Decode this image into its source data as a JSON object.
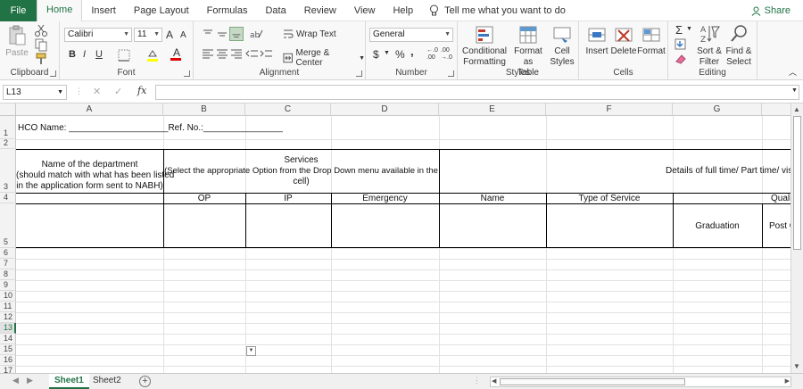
{
  "tabs": {
    "file": "File",
    "items": [
      "Home",
      "Insert",
      "Page Layout",
      "Formulas",
      "Data",
      "Review",
      "View",
      "Help"
    ],
    "tell": "Tell me what you want to do",
    "share": "Share"
  },
  "ribbon": {
    "clipboard": {
      "paste": "Paste",
      "label": "Clipboard"
    },
    "font": {
      "name": "Calibri",
      "size": "11",
      "bold": "B",
      "italic": "I",
      "underline": "U",
      "grow": "A",
      "shrink": "A",
      "label": "Font"
    },
    "alignment": {
      "wrap": "Wrap Text",
      "merge": "Merge & Center",
      "label": "Alignment"
    },
    "number": {
      "format": "General",
      "currency": "$",
      "percent": "%",
      "comma": ",",
      "inc": "←.0 .00",
      "dec": ".00 →.0",
      "label": "Number"
    },
    "styles": {
      "conditional_1": "Conditional",
      "conditional_2": "Formatting",
      "table_1": "Format as",
      "table_2": "Table",
      "cell_1": "Cell",
      "cell_2": "Styles",
      "label": "Styles"
    },
    "cells": {
      "insert": "Insert",
      "delete": "Delete",
      "format": "Format",
      "label": "Cells"
    },
    "editing": {
      "sort_1": "Sort &",
      "sort_2": "Filter",
      "find_1": "Find &",
      "find_2": "Select",
      "label": "Editing"
    }
  },
  "formula_bar": {
    "name_box": "L13",
    "fx": "fx",
    "value": ""
  },
  "grid": {
    "columns": [
      "A",
      "B",
      "C",
      "D",
      "E",
      "F",
      "G"
    ],
    "rows": [
      "1",
      "2",
      "3",
      "4",
      "5",
      "6",
      "7",
      "8",
      "9",
      "10",
      "11",
      "12",
      "13",
      "14",
      "15",
      "16",
      "17"
    ],
    "selected_row": "13",
    "cells": {
      "hco": "HCO Name: ____________________Ref. No.:________________",
      "dept_1": "Name of the department",
      "dept_2": "(should match with what has been listed",
      "dept_3": "in the application form sent to NABH)",
      "services_1": "Services",
      "services_2": "(Select the appropriate Option from the Drop Down menu available in the",
      "services_3": "cell)",
      "details": "Details of full time/ Part time/ visiti",
      "op": "OP",
      "ip": "IP",
      "emergency": "Emergency",
      "name": "Name",
      "type_service": "Type of Service",
      "quali": "Quali",
      "graduation": "Graduation",
      "post": "Post G"
    }
  },
  "sheets": {
    "tabs": [
      "Sheet1",
      "Sheet2"
    ],
    "active": "Sheet1"
  }
}
